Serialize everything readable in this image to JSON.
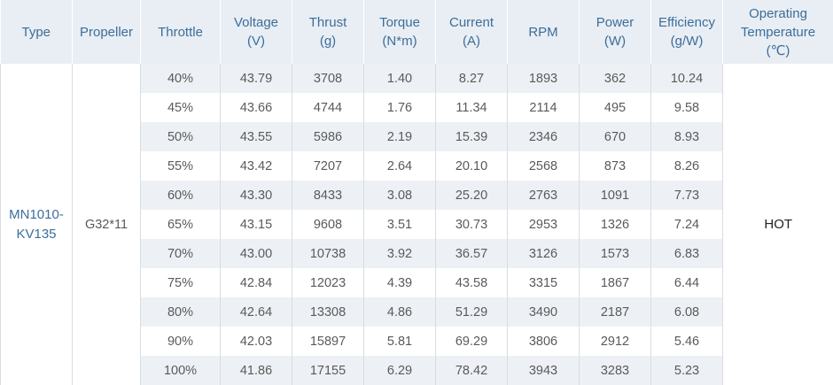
{
  "headers": {
    "type": "Type",
    "propeller": "Propeller",
    "throttle": "Throttle",
    "voltage": "Voltage",
    "voltage_unit": "(V)",
    "thrust": "Thrust",
    "thrust_unit": "(g)",
    "torque": "Torque",
    "torque_unit": "(N*m)",
    "current": "Current",
    "current_unit": "(A)",
    "rpm": "RPM",
    "power": "Power",
    "power_unit": "(W)",
    "efficiency": "Efficiency",
    "efficiency_unit": "(g/W)",
    "op_temp_line1": "Operating",
    "op_temp_line2": "Temperature",
    "op_temp_unit": "(℃)"
  },
  "type_line1": "MN1010-",
  "type_line2": "KV135",
  "propeller": "G32*11",
  "operating_temperature": "HOT",
  "rows": [
    [
      "40%",
      "43.79",
      "3708",
      "1.40",
      "8.27",
      "1893",
      "362",
      "10.24"
    ],
    [
      "45%",
      "43.66",
      "4744",
      "1.76",
      "11.34",
      "2114",
      "495",
      "9.58"
    ],
    [
      "50%",
      "43.55",
      "5986",
      "2.19",
      "15.39",
      "2346",
      "670",
      "8.93"
    ],
    [
      "55%",
      "43.42",
      "7207",
      "2.64",
      "20.10",
      "2568",
      "873",
      "8.26"
    ],
    [
      "60%",
      "43.30",
      "8433",
      "3.08",
      "25.20",
      "2763",
      "1091",
      "7.73"
    ],
    [
      "65%",
      "43.15",
      "9608",
      "3.51",
      "30.73",
      "2953",
      "1326",
      "7.24"
    ],
    [
      "70%",
      "43.00",
      "10738",
      "3.92",
      "36.57",
      "3126",
      "1573",
      "6.83"
    ],
    [
      "75%",
      "42.84",
      "12023",
      "4.39",
      "43.58",
      "3315",
      "1867",
      "6.44"
    ],
    [
      "80%",
      "42.64",
      "13308",
      "4.86",
      "51.29",
      "3490",
      "2187",
      "6.08"
    ],
    [
      "90%",
      "42.03",
      "15897",
      "5.81",
      "69.29",
      "3806",
      "2912",
      "5.46"
    ],
    [
      "100%",
      "41.86",
      "17155",
      "6.29",
      "78.42",
      "3943",
      "3283",
      "5.23"
    ]
  ]
}
